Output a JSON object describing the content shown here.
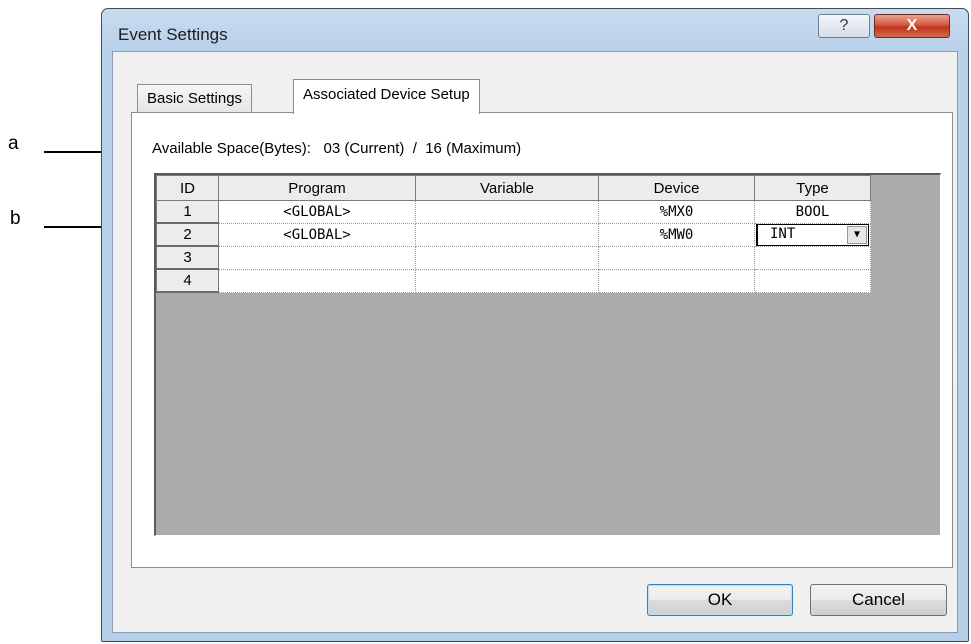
{
  "annotations": {
    "a": "a",
    "b": "b"
  },
  "dialog": {
    "title": "Event Settings",
    "help_label": "?",
    "close_label": "X"
  },
  "tabs": [
    {
      "label": "Basic Settings",
      "active": false
    },
    {
      "label": "Associated Device Setup",
      "active": true
    }
  ],
  "space": {
    "label": "Available Space(Bytes):",
    "current": "03 (Current)",
    "separator": "/",
    "maximum": "16 (Maximum)"
  },
  "grid": {
    "headers": [
      "ID",
      "Program",
      "Variable",
      "Device",
      "Type"
    ],
    "rows": [
      {
        "id": "1",
        "program": "<GLOBAL>",
        "variable": "",
        "device": "%MX0",
        "type": "BOOL"
      },
      {
        "id": "2",
        "program": "<GLOBAL>",
        "variable": "",
        "device": "%MW0",
        "type": "INT"
      },
      {
        "id": "3",
        "program": "",
        "variable": "",
        "device": "",
        "type": ""
      },
      {
        "id": "4",
        "program": "",
        "variable": "",
        "device": "",
        "type": ""
      }
    ]
  },
  "buttons": {
    "ok": "OK",
    "cancel": "Cancel"
  },
  "colors": {
    "title_bar": "#b9d1ea",
    "close_button": "#c2341c",
    "ok_border": "#3c7fb1"
  }
}
